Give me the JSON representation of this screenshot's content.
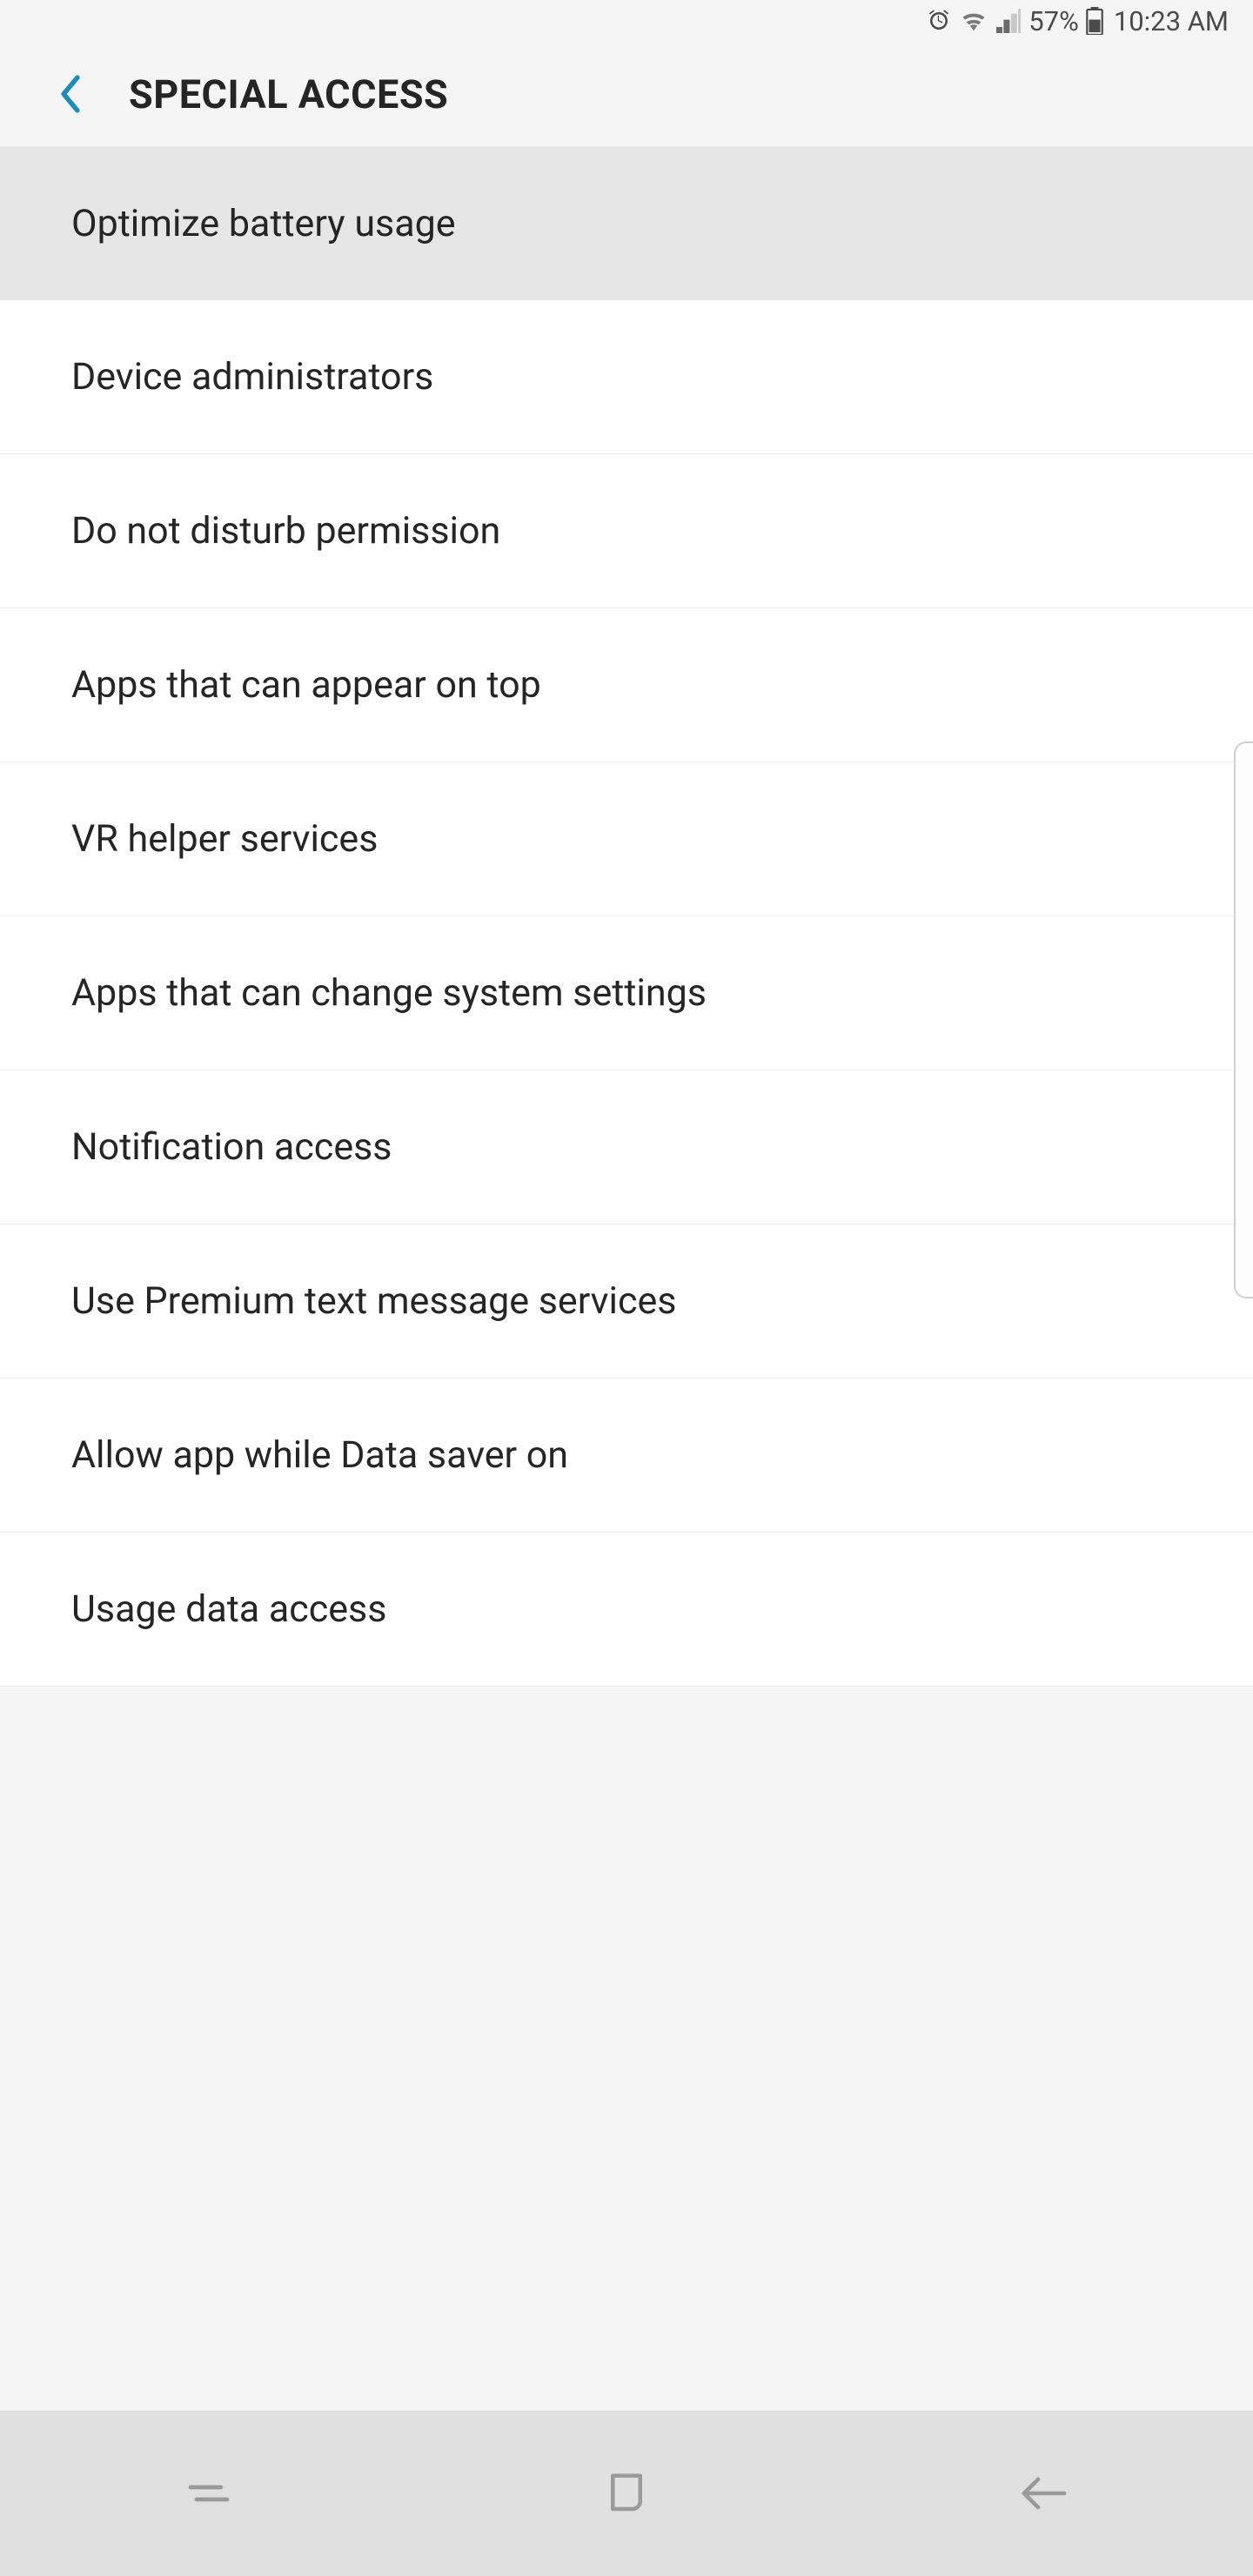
{
  "status_bar": {
    "battery_percent": "57%",
    "time": "10:23 AM"
  },
  "header": {
    "title": "SPECIAL ACCESS"
  },
  "list": {
    "items": [
      {
        "label": "Optimize battery usage"
      },
      {
        "label": "Device administrators"
      },
      {
        "label": "Do not disturb permission"
      },
      {
        "label": "Apps that can appear on top"
      },
      {
        "label": "VR helper services"
      },
      {
        "label": "Apps that can change system settings"
      },
      {
        "label": "Notification access"
      },
      {
        "label": "Use Premium text message services"
      },
      {
        "label": "Allow app while Data saver on"
      },
      {
        "label": "Usage data access"
      }
    ]
  }
}
